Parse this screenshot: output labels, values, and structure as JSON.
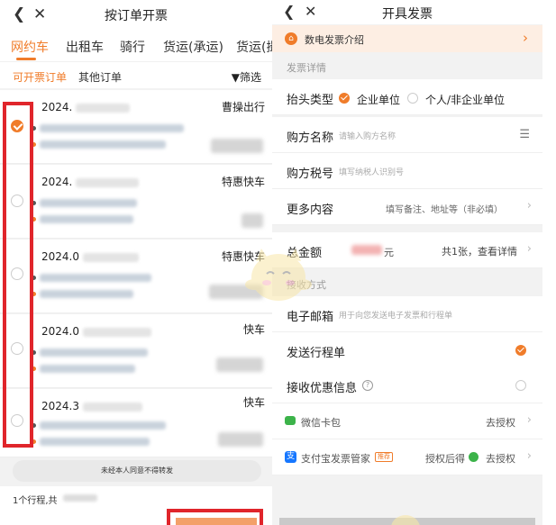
{
  "left": {
    "title": "按订单开票",
    "tabs": [
      "网约车",
      "出租车",
      "骑行",
      "货运(承运)",
      "货运(撮"
    ],
    "active_tab": 0,
    "subtabs": {
      "invoiceable": "可开票订单",
      "other": "其他订单",
      "filter": "▼筛选"
    },
    "orders": [
      {
        "date": "2024.",
        "service": "曹操出行",
        "selected": true
      },
      {
        "date": "2024.",
        "service": "特惠快车",
        "selected": false
      },
      {
        "date": "2024.0",
        "service": "特惠快车",
        "selected": false
      },
      {
        "date": "2024.0",
        "service": "快车",
        "selected": false
      },
      {
        "date": "2024.3",
        "service": "快车",
        "selected": false
      }
    ],
    "notice": "未经本人同意不得转发",
    "count_text": "1个行程,共"
  },
  "right": {
    "title": "开具发票",
    "banner": "数电发票介绍",
    "section_details": "发票详情",
    "header_type_label": "抬头类型",
    "header_type_options": [
      "企业单位",
      "个人/非企业单位"
    ],
    "buyer_name": {
      "label": "购方名称",
      "placeholder": "请输入购方名称"
    },
    "buyer_tax": {
      "label": "购方税号",
      "placeholder": "填写纳税人识别号"
    },
    "more": {
      "label": "更多内容",
      "placeholder": "填写备注、地址等（非必填）"
    },
    "total": {
      "label": "总金额",
      "amount_suffix": "元",
      "detail": "共1张，查看详情"
    },
    "section_receive": "接收方式",
    "email": {
      "label": "电子邮箱",
      "placeholder": "用于向您发送电子发票和行程单"
    },
    "send_itinerary": "发送行程单",
    "receive_promo": "接收优惠信息",
    "wechat": {
      "label": "微信卡包",
      "action": "去授权"
    },
    "alipay": {
      "label": "支付宝发票管家",
      "badge": "推荐",
      "action1": "授权后得",
      "action2": "去授权"
    }
  }
}
